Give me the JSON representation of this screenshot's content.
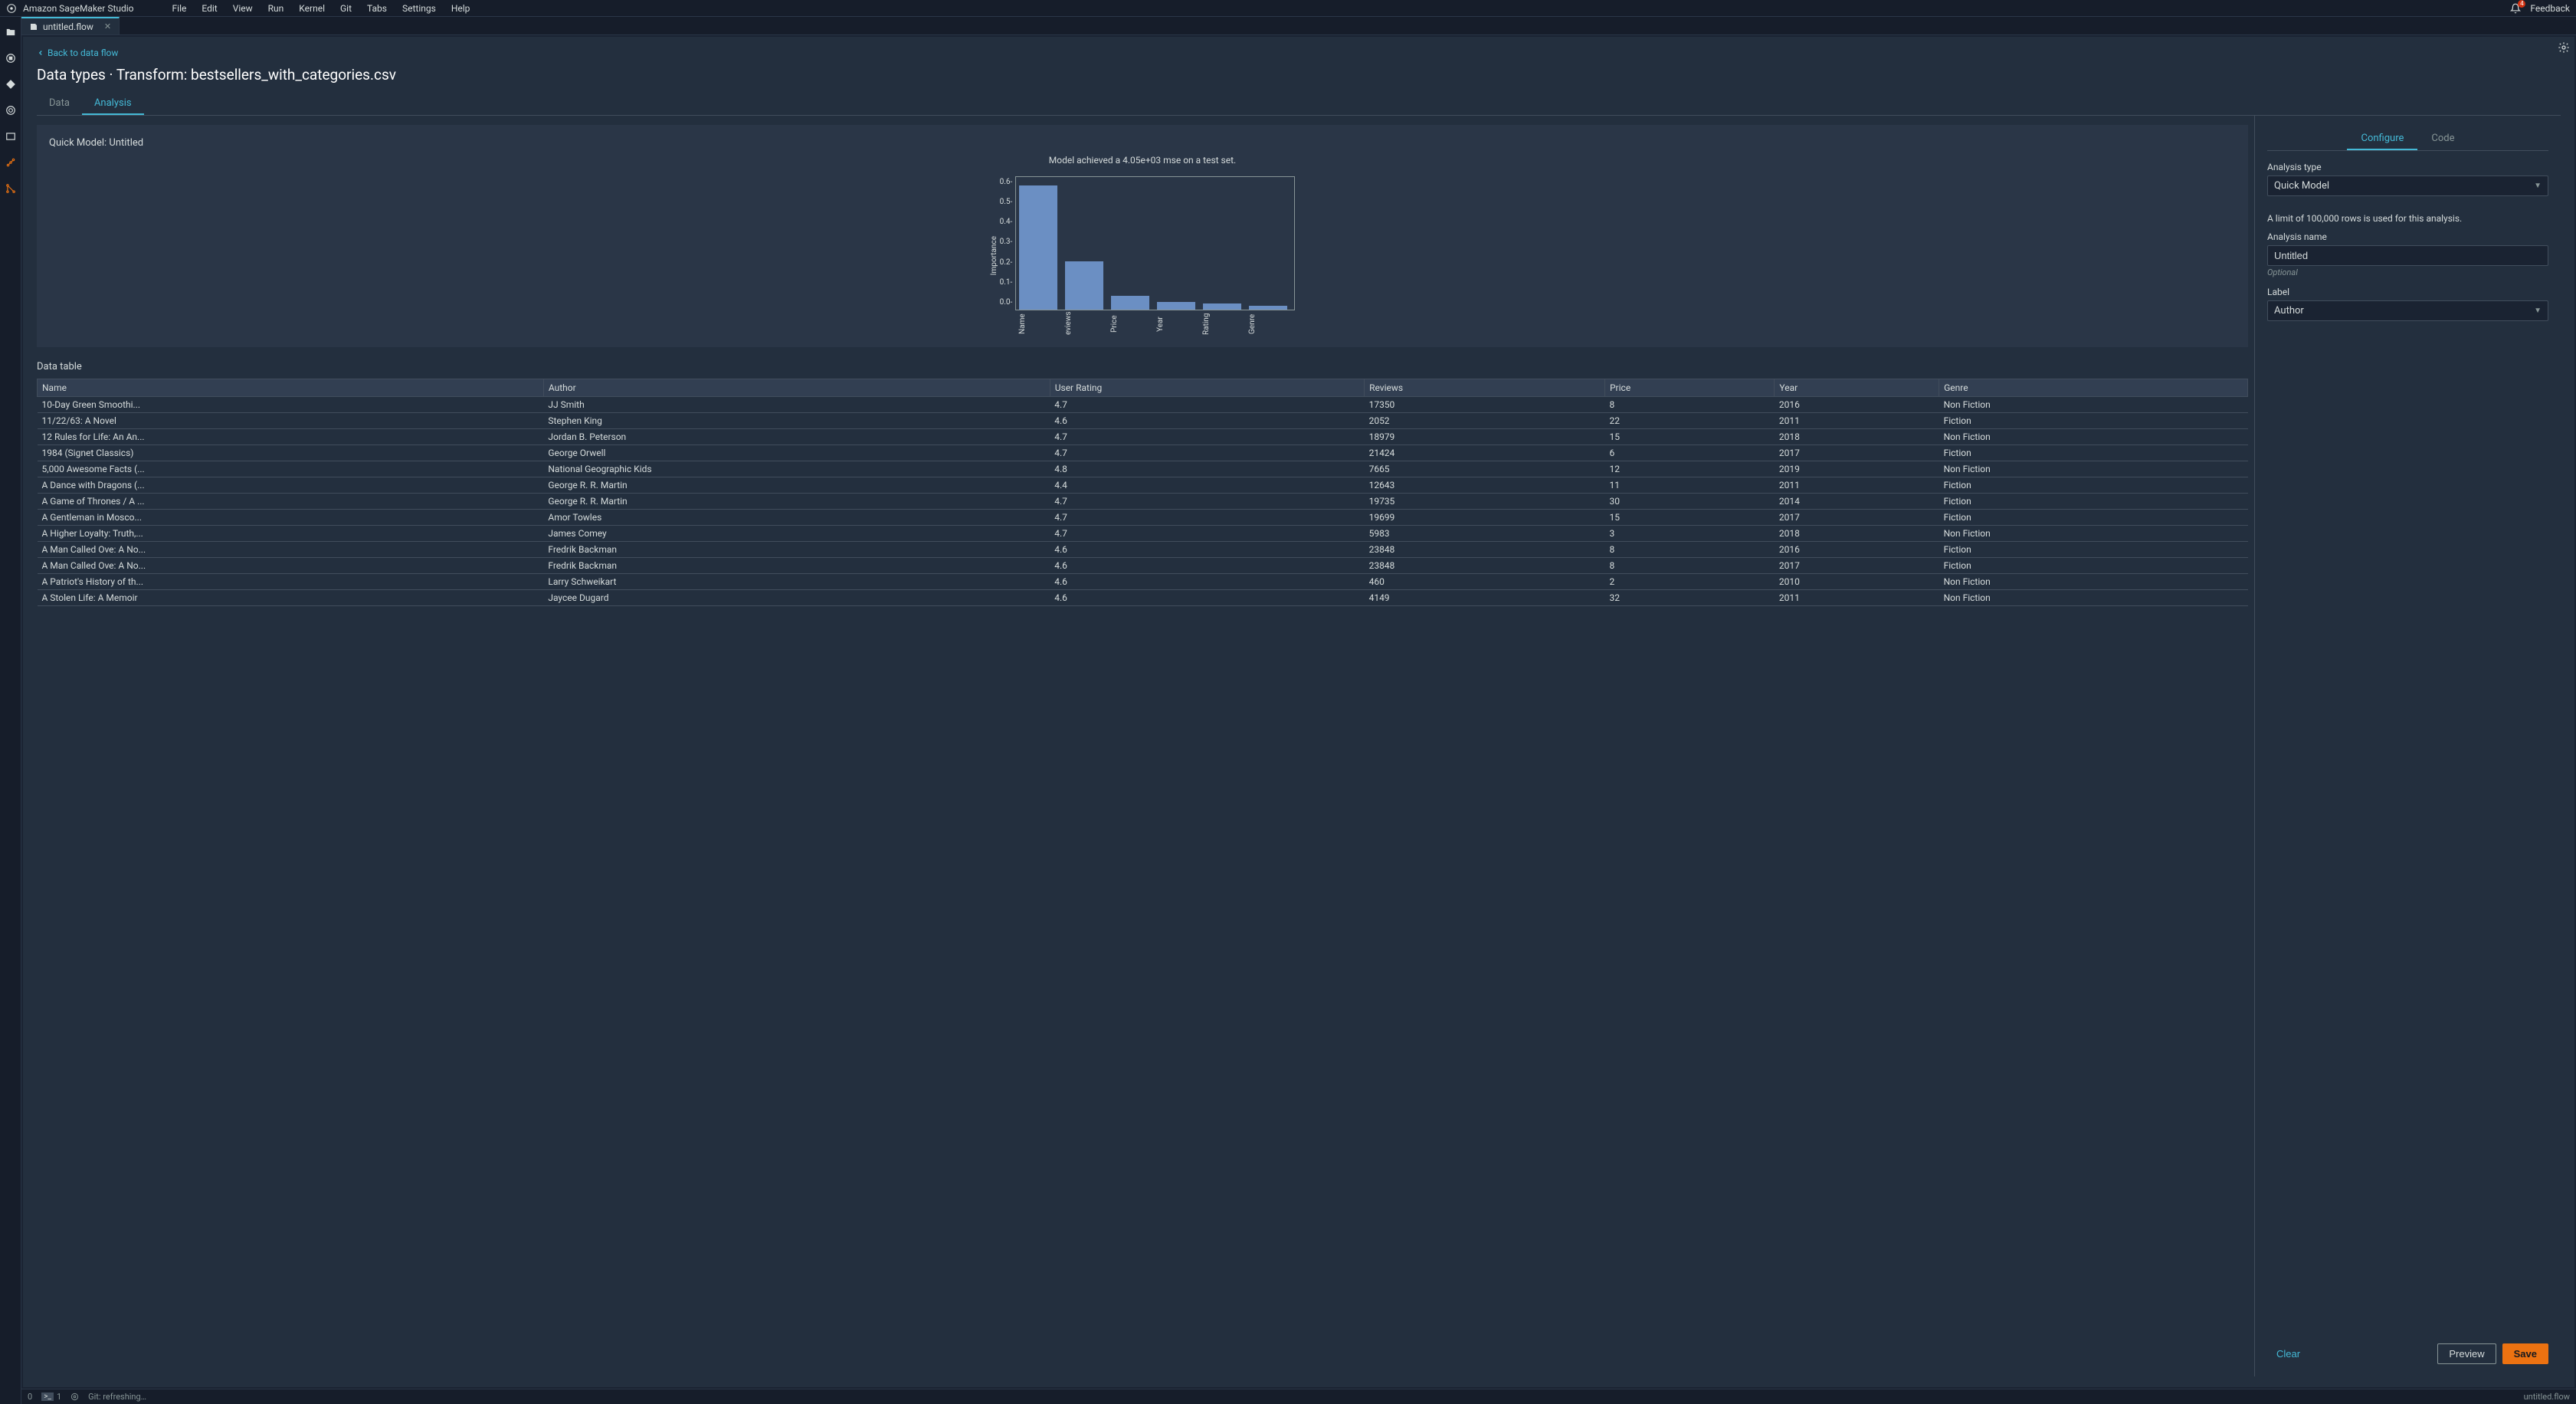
{
  "app_title": "Amazon SageMaker Studio",
  "menus": [
    "File",
    "Edit",
    "View",
    "Run",
    "Kernel",
    "Git",
    "Tabs",
    "Settings",
    "Help"
  ],
  "notifications_count": "4",
  "feedback_label": "Feedback",
  "doc_tab": {
    "label": "untitled.flow"
  },
  "back_link": "Back to data flow",
  "page_title": "Data types · Transform: bestsellers_with_categories.csv",
  "sub_tabs": {
    "data": "Data",
    "analysis": "Analysis"
  },
  "card": {
    "label": "Quick Model: Untitled",
    "caption": "Model achieved a 4.05e+03 mse on a test set."
  },
  "chart_data": {
    "type": "bar",
    "ylabel": "Importance",
    "ylim": [
      0,
      0.65
    ],
    "yticks": [
      "0.6-",
      "0.5-",
      "0.4-",
      "0.3-",
      "0.2-",
      "0.1-",
      "0.0-"
    ],
    "categories": [
      "Name",
      "eviews",
      "Price",
      "Year",
      "Rating",
      "Genre"
    ],
    "values": [
      0.62,
      0.24,
      0.07,
      0.04,
      0.03,
      0.02
    ]
  },
  "data_table_label": "Data table",
  "table": {
    "columns": [
      "Name",
      "Author",
      "User Rating",
      "Reviews",
      "Price",
      "Year",
      "Genre"
    ],
    "rows": [
      [
        "10-Day Green Smoothi...",
        "JJ Smith",
        "4.7",
        "17350",
        "8",
        "2016",
        "Non Fiction"
      ],
      [
        "11/22/63: A Novel",
        "Stephen King",
        "4.6",
        "2052",
        "22",
        "2011",
        "Fiction"
      ],
      [
        "12 Rules for Life: An An...",
        "Jordan B. Peterson",
        "4.7",
        "18979",
        "15",
        "2018",
        "Non Fiction"
      ],
      [
        "1984 (Signet Classics)",
        "George Orwell",
        "4.7",
        "21424",
        "6",
        "2017",
        "Fiction"
      ],
      [
        "5,000 Awesome Facts (...",
        "National Geographic Kids",
        "4.8",
        "7665",
        "12",
        "2019",
        "Non Fiction"
      ],
      [
        "A Dance with Dragons (...",
        "George R. R. Martin",
        "4.4",
        "12643",
        "11",
        "2011",
        "Fiction"
      ],
      [
        "A Game of Thrones / A ...",
        "George R. R. Martin",
        "4.7",
        "19735",
        "30",
        "2014",
        "Fiction"
      ],
      [
        "A Gentleman in Mosco...",
        "Amor Towles",
        "4.7",
        "19699",
        "15",
        "2017",
        "Fiction"
      ],
      [
        "A Higher Loyalty: Truth,...",
        "James Comey",
        "4.7",
        "5983",
        "3",
        "2018",
        "Non Fiction"
      ],
      [
        "A Man Called Ove: A No...",
        "Fredrik Backman",
        "4.6",
        "23848",
        "8",
        "2016",
        "Fiction"
      ],
      [
        "A Man Called Ove: A No...",
        "Fredrik Backman",
        "4.6",
        "23848",
        "8",
        "2017",
        "Fiction"
      ],
      [
        "A Patriot's History of th...",
        "Larry Schweikart",
        "4.6",
        "460",
        "2",
        "2010",
        "Non Fiction"
      ],
      [
        "A Stolen Life: A Memoir",
        "Jaycee Dugard",
        "4.6",
        "4149",
        "32",
        "2011",
        "Non Fiction"
      ]
    ]
  },
  "config": {
    "tabs": {
      "configure": "Configure",
      "code": "Code"
    },
    "analysis_type_label": "Analysis type",
    "analysis_type_value": "Quick Model",
    "limit_note": "A limit of 100,000 rows is used for this analysis.",
    "analysis_name_label": "Analysis name",
    "analysis_name_value": "Untitled",
    "optional_hint": "Optional",
    "label_label": "Label",
    "label_value": "Author",
    "clear": "Clear",
    "preview": "Preview",
    "save": "Save"
  },
  "status": {
    "left_zero": "0",
    "term": "1",
    "git": "Git: refreshing…",
    "right_file": "untitled.flow"
  }
}
